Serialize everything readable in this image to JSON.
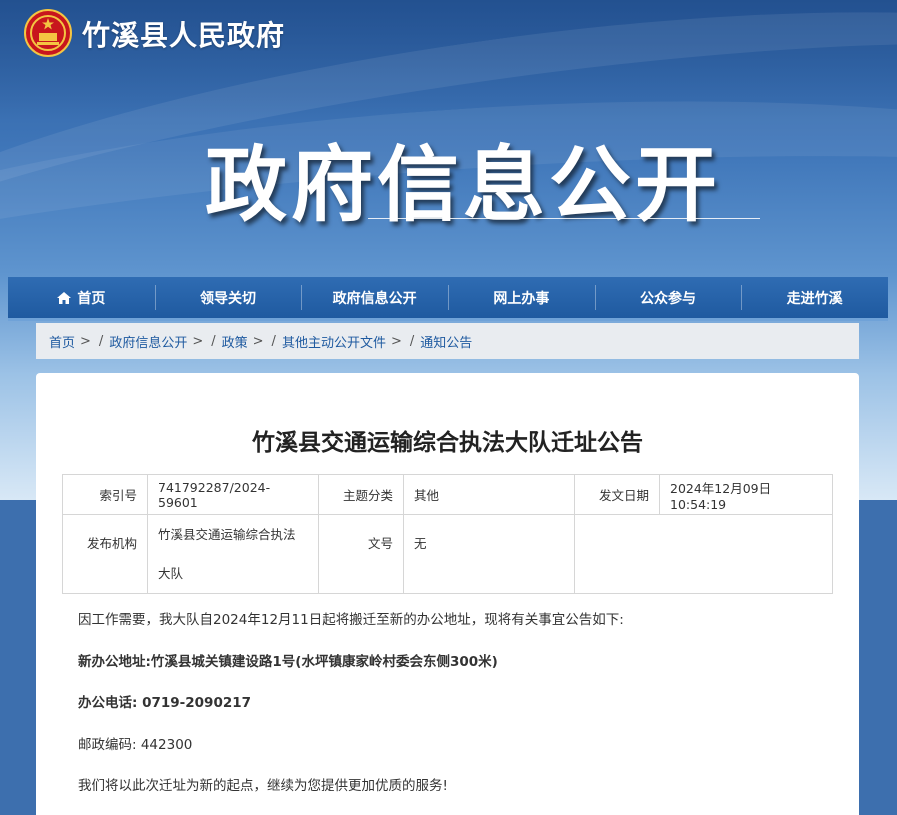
{
  "header": {
    "site_title": "竹溪县人民政府",
    "banner_title": "政府信息公开",
    "logo_icon": "national-emblem-icon"
  },
  "nav": {
    "items": [
      {
        "label": "首页",
        "icon": "home-icon"
      },
      {
        "label": "领导关切"
      },
      {
        "label": "政府信息公开"
      },
      {
        "label": "网上办事"
      },
      {
        "label": "公众参与"
      },
      {
        "label": "走进竹溪"
      }
    ]
  },
  "breadcrumb": {
    "items": [
      "首页",
      "政府信息公开",
      "政策",
      "其他主动公开文件",
      "通知公告"
    ],
    "separator": ">"
  },
  "article": {
    "title": "竹溪县交通运输综合执法大队迁址公告",
    "meta": {
      "index_label": "索引号",
      "index_value": "741792287/2024-59601",
      "category_label": "主题分类",
      "category_value": "其他",
      "date_label": "发文日期",
      "date_value": "2024年12月09日 10:54:19",
      "publisher_label": "发布机构",
      "publisher_value_line1": "竹溪县交通运输综合执法",
      "publisher_value_line2": "大队",
      "docno_label": "文号",
      "docno_value": "无"
    },
    "paragraphs": [
      "因工作需要，我大队自2024年12月11日起将搬迁至新的办公地址，现将有关事宜公告如下:",
      "新办公地址:竹溪县城关镇建设路1号(水坪镇康家岭村委会东侧300米)",
      "办公电话: 0719-2090217",
      "邮政编码: 442300",
      "我们将以此次迁址为新的起点，继续为您提供更加优质的服务!"
    ]
  },
  "colors": {
    "nav_bg": "#1f5aa0",
    "link": "#1f5aa0",
    "breadcrumb_bg": "#e9ecf0"
  }
}
